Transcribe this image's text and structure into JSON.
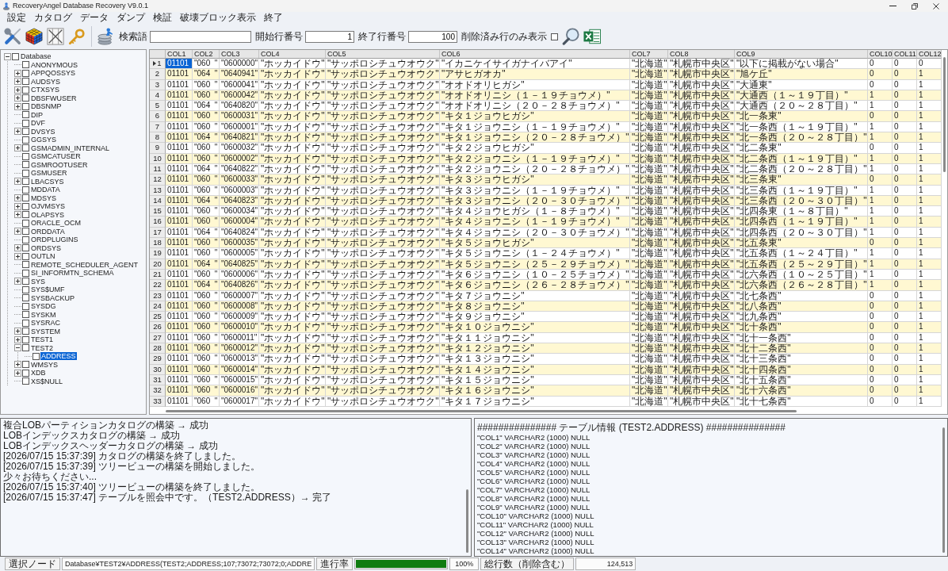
{
  "window": {
    "title": "RecoveryAngel Database Recovery V9.0.1"
  },
  "menu": [
    "設定",
    "カタログ",
    "データ",
    "ダンプ",
    "検証",
    "破壊ブロック表示",
    "終了"
  ],
  "toolbar": {
    "search": {
      "label": "検索語"
    },
    "start_row": {
      "label": "開始行番号",
      "value": "1"
    },
    "end_row": {
      "label": "終了行番号",
      "value": "100"
    },
    "deleted_only": {
      "label": "削除済み行のみ表示",
      "checked": false
    }
  },
  "tree": [
    {
      "label": "Database",
      "checked": false,
      "selected": false,
      "expanded": true,
      "children": [
        {
          "label": "ANONYMOUS",
          "checked": false,
          "selected": false
        },
        {
          "label": "APPQOSSYS",
          "checked": false,
          "selected": false,
          "expanded": false
        },
        {
          "label": "AUDSYS",
          "checked": false,
          "selected": false,
          "expanded": false
        },
        {
          "label": "CTXSYS",
          "checked": false,
          "selected": false,
          "expanded": false
        },
        {
          "label": "DBSFWUSER",
          "checked": false,
          "selected": false,
          "expanded": false
        },
        {
          "label": "DBSNMP",
          "checked": false,
          "selected": false,
          "expanded": false
        },
        {
          "label": "DIP",
          "checked": false,
          "selected": false
        },
        {
          "label": "DVF",
          "checked": false,
          "selected": false
        },
        {
          "label": "DVSYS",
          "checked": false,
          "selected": false,
          "expanded": false
        },
        {
          "label": "GGSYS",
          "checked": false,
          "selected": false
        },
        {
          "label": "GSMADMIN_INTERNAL",
          "checked": false,
          "selected": false,
          "expanded": false
        },
        {
          "label": "GSMCATUSER",
          "checked": false,
          "selected": false
        },
        {
          "label": "GSMROOTUSER",
          "checked": false,
          "selected": false
        },
        {
          "label": "GSMUSER",
          "checked": false,
          "selected": false
        },
        {
          "label": "LBACSYS",
          "checked": false,
          "selected": false,
          "expanded": false
        },
        {
          "label": "MDDATA",
          "checked": false,
          "selected": false
        },
        {
          "label": "MDSYS",
          "checked": false,
          "selected": false,
          "expanded": false
        },
        {
          "label": "OJVMSYS",
          "checked": false,
          "selected": false,
          "expanded": false
        },
        {
          "label": "OLAPSYS",
          "checked": false,
          "selected": false,
          "expanded": false
        },
        {
          "label": "ORACLE_OCM",
          "checked": false,
          "selected": false
        },
        {
          "label": "ORDDATA",
          "checked": false,
          "selected": false,
          "expanded": false
        },
        {
          "label": "ORDPLUGINS",
          "checked": false,
          "selected": false
        },
        {
          "label": "ORDSYS",
          "checked": false,
          "selected": false,
          "expanded": false
        },
        {
          "label": "OUTLN",
          "checked": false,
          "selected": false,
          "expanded": false
        },
        {
          "label": "REMOTE_SCHEDULER_AGENT",
          "checked": false,
          "selected": false
        },
        {
          "label": "SI_INFORMTN_SCHEMA",
          "checked": false,
          "selected": false
        },
        {
          "label": "SYS",
          "checked": false,
          "selected": false,
          "expanded": false
        },
        {
          "label": "SYS$UMF",
          "checked": false,
          "selected": false
        },
        {
          "label": "SYSBACKUP",
          "checked": false,
          "selected": false
        },
        {
          "label": "SYSDG",
          "checked": false,
          "selected": false
        },
        {
          "label": "SYSKM",
          "checked": false,
          "selected": false
        },
        {
          "label": "SYSRAC",
          "checked": false,
          "selected": false
        },
        {
          "label": "SYSTEM",
          "checked": false,
          "selected": false,
          "expanded": false
        },
        {
          "label": "TEST1",
          "checked": false,
          "selected": false,
          "expanded": false
        },
        {
          "label": "TEST2",
          "checked": false,
          "selected": false,
          "expanded": true,
          "children": [
            {
              "label": "ADDRESS",
              "checked": false,
              "selected": true
            }
          ]
        },
        {
          "label": "WMSYS",
          "checked": false,
          "selected": false,
          "expanded": false
        },
        {
          "label": "XDB",
          "checked": false,
          "selected": false,
          "expanded": false
        },
        {
          "label": "XS$NULL",
          "checked": false,
          "selected": false
        }
      ]
    }
  ],
  "table": {
    "columns": [
      "COL1",
      "COL2",
      "COL3",
      "COL4",
      "COL5",
      "COL6",
      "COL7",
      "COL8",
      "COL9",
      "COL10",
      "COL11",
      "COL12"
    ],
    "rows": [
      {
        "number": "1",
        "selected": true,
        "cells": [
          "01101",
          "\"060  \"",
          "\"0600000\"",
          "\"ホッカイドウ\"",
          "\"サッポロシチュウオウク\"",
          "\"イカニケイサイガナイバアイ\"",
          "\"北海道\"",
          "\"札幌市中央区\"",
          "\"以下に掲載がない場合\"",
          "0",
          "0",
          "0"
        ]
      },
      {
        "number": "2",
        "selected": false,
        "cells": [
          "01101",
          "\"064  \"",
          "\"0640941\"",
          "\"ホッカイドウ\"",
          "\"サッポロシチュウオウク\"",
          "\"アサヒガオカ\"",
          "\"北海道\"",
          "\"札幌市中央区\"",
          "\"旭ケ丘\"",
          "0",
          "0",
          "1"
        ]
      },
      {
        "number": "3",
        "selected": false,
        "cells": [
          "01101",
          "\"060  \"",
          "\"0600041\"",
          "\"ホッカイドウ\"",
          "\"サッポロシチュウオウク\"",
          "\"オオドオリヒガシ\"",
          "\"北海道\"",
          "\"札幌市中央区\"",
          "\"大通東\"",
          "0",
          "0",
          "1"
        ]
      },
      {
        "number": "4",
        "selected": false,
        "cells": [
          "01101",
          "\"060  \"",
          "\"0600042\"",
          "\"ホッカイドウ\"",
          "\"サッポロシチュウオウク\"",
          "\"オオドオリニシ（１－１９チョウメ）\"",
          "\"北海道\"",
          "\"札幌市中央区\"",
          "\"大通西（１～１９丁目）\"",
          "1",
          "0",
          "1"
        ]
      },
      {
        "number": "5",
        "selected": false,
        "cells": [
          "01101",
          "\"064  \"",
          "\"0640820\"",
          "\"ホッカイドウ\"",
          "\"サッポロシチュウオウク\"",
          "\"オオドオリニシ（２０－２８チョウメ）\"",
          "\"北海道\"",
          "\"札幌市中央区\"",
          "\"大通西（２０～２８丁目）\"",
          "1",
          "0",
          "1"
        ]
      },
      {
        "number": "6",
        "selected": false,
        "cells": [
          "01101",
          "\"060  \"",
          "\"0600031\"",
          "\"ホッカイドウ\"",
          "\"サッポロシチュウオウク\"",
          "\"キタ１ジョウヒガシ\"",
          "\"北海道\"",
          "\"札幌市中央区\"",
          "\"北一条東\"",
          "0",
          "0",
          "1"
        ]
      },
      {
        "number": "7",
        "selected": false,
        "cells": [
          "01101",
          "\"060  \"",
          "\"0600001\"",
          "\"ホッカイドウ\"",
          "\"サッポロシチュウオウク\"",
          "\"キタ１ジョウニシ（１－１９チョウメ）\"",
          "\"北海道\"",
          "\"札幌市中央区\"",
          "\"北一条西（１～１９丁目）\"",
          "1",
          "0",
          "1"
        ]
      },
      {
        "number": "8",
        "selected": false,
        "cells": [
          "01101",
          "\"064  \"",
          "\"0640821\"",
          "\"ホッカイドウ\"",
          "\"サッポロシチュウオウク\"",
          "\"キタ１ジョウニシ（２０－２８チョウメ）\"",
          "\"北海道\"",
          "\"札幌市中央区\"",
          "\"北一条西（２０～２８丁目）\"",
          "1",
          "0",
          "1"
        ]
      },
      {
        "number": "9",
        "selected": false,
        "cells": [
          "01101",
          "\"060  \"",
          "\"0600032\"",
          "\"ホッカイドウ\"",
          "\"サッポロシチュウオウク\"",
          "\"キタ２ジョウヒガシ\"",
          "\"北海道\"",
          "\"札幌市中央区\"",
          "\"北二条東\"",
          "0",
          "0",
          "1"
        ]
      },
      {
        "number": "10",
        "selected": false,
        "cells": [
          "01101",
          "\"060  \"",
          "\"0600002\"",
          "\"ホッカイドウ\"",
          "\"サッポロシチュウオウク\"",
          "\"キタ２ジョウニシ（１－１９チョウメ）\"",
          "\"北海道\"",
          "\"札幌市中央区\"",
          "\"北二条西（１～１９丁目）\"",
          "1",
          "0",
          "1"
        ]
      },
      {
        "number": "11",
        "selected": false,
        "cells": [
          "01101",
          "\"064  \"",
          "\"0640822\"",
          "\"ホッカイドウ\"",
          "\"サッポロシチュウオウク\"",
          "\"キタ２ジョウニシ（２０－２８チョウメ）\"",
          "\"北海道\"",
          "\"札幌市中央区\"",
          "\"北二条西（２０～２８丁目）\"",
          "1",
          "0",
          "1"
        ]
      },
      {
        "number": "12",
        "selected": false,
        "cells": [
          "01101",
          "\"060  \"",
          "\"0600033\"",
          "\"ホッカイドウ\"",
          "\"サッポロシチュウオウク\"",
          "\"キタ３ジョウヒガシ\"",
          "\"北海道\"",
          "\"札幌市中央区\"",
          "\"北三条東\"",
          "0",
          "0",
          "1"
        ]
      },
      {
        "number": "13",
        "selected": false,
        "cells": [
          "01101",
          "\"060  \"",
          "\"0600003\"",
          "\"ホッカイドウ\"",
          "\"サッポロシチュウオウク\"",
          "\"キタ３ジョウニシ（１－１９チョウメ）\"",
          "\"北海道\"",
          "\"札幌市中央区\"",
          "\"北三条西（１～１９丁目）\"",
          "1",
          "0",
          "1"
        ]
      },
      {
        "number": "14",
        "selected": false,
        "cells": [
          "01101",
          "\"064  \"",
          "\"0640823\"",
          "\"ホッカイドウ\"",
          "\"サッポロシチュウオウク\"",
          "\"キタ３ジョウニシ（２０－３０チョウメ）\"",
          "\"北海道\"",
          "\"札幌市中央区\"",
          "\"北三条西（２０～３０丁目）\"",
          "1",
          "0",
          "1"
        ]
      },
      {
        "number": "15",
        "selected": false,
        "cells": [
          "01101",
          "\"060  \"",
          "\"0600034\"",
          "\"ホッカイドウ\"",
          "\"サッポロシチュウオウク\"",
          "\"キタ４ジョウヒガシ（１－８チョウメ）\"",
          "\"北海道\"",
          "\"札幌市中央区\"",
          "\"北四条東（１～８丁目）\"",
          "1",
          "0",
          "1"
        ]
      },
      {
        "number": "16",
        "selected": false,
        "cells": [
          "01101",
          "\"060  \"",
          "\"0600004\"",
          "\"ホッカイドウ\"",
          "\"サッポロシチュウオウク\"",
          "\"キタ４ジョウニシ（１－１９チョウメ）\"",
          "\"北海道\"",
          "\"札幌市中央区\"",
          "\"北四条西（１～１９丁目）\"",
          "1",
          "0",
          "1"
        ]
      },
      {
        "number": "17",
        "selected": false,
        "cells": [
          "01101",
          "\"064  \"",
          "\"0640824\"",
          "\"ホッカイドウ\"",
          "\"サッポロシチュウオウク\"",
          "\"キタ４ジョウニシ（２０－３０チョウメ）\"",
          "\"北海道\"",
          "\"札幌市中央区\"",
          "\"北四条西（２０～３０丁目）\"",
          "1",
          "0",
          "1"
        ]
      },
      {
        "number": "18",
        "selected": false,
        "cells": [
          "01101",
          "\"060  \"",
          "\"0600035\"",
          "\"ホッカイドウ\"",
          "\"サッポロシチュウオウク\"",
          "\"キタ５ジョウヒガシ\"",
          "\"北海道\"",
          "\"札幌市中央区\"",
          "\"北五条東\"",
          "0",
          "0",
          "1"
        ]
      },
      {
        "number": "19",
        "selected": false,
        "cells": [
          "01101",
          "\"060  \"",
          "\"0600005\"",
          "\"ホッカイドウ\"",
          "\"サッポロシチュウオウク\"",
          "\"キタ５ジョウニシ（１－２４チョウメ）\"",
          "\"北海道\"",
          "\"札幌市中央区\"",
          "\"北五条西（１～２４丁目）\"",
          "1",
          "0",
          "1"
        ]
      },
      {
        "number": "20",
        "selected": false,
        "cells": [
          "01101",
          "\"064  \"",
          "\"0640825\"",
          "\"ホッカイドウ\"",
          "\"サッポロシチュウオウク\"",
          "\"キタ５ジョウニシ（２５－２９チョウメ）\"",
          "\"北海道\"",
          "\"札幌市中央区\"",
          "\"北五条西（２５～２９丁目）\"",
          "1",
          "0",
          "1"
        ]
      },
      {
        "number": "21",
        "selected": false,
        "cells": [
          "01101",
          "\"060  \"",
          "\"0600006\"",
          "\"ホッカイドウ\"",
          "\"サッポロシチュウオウク\"",
          "\"キタ６ジョウニシ（１０－２５チョウメ）\"",
          "\"北海道\"",
          "\"札幌市中央区\"",
          "\"北六条西（１０～２５丁目）\"",
          "1",
          "0",
          "1"
        ]
      },
      {
        "number": "22",
        "selected": false,
        "cells": [
          "01101",
          "\"064  \"",
          "\"0640826\"",
          "\"ホッカイドウ\"",
          "\"サッポロシチュウオウク\"",
          "\"キタ６ジョウニシ（２６－２８チョウメ）\"",
          "\"北海道\"",
          "\"札幌市中央区\"",
          "\"北六条西（２６～２８丁目）\"",
          "1",
          "0",
          "1"
        ]
      },
      {
        "number": "23",
        "selected": false,
        "cells": [
          "01101",
          "\"060  \"",
          "\"0600007\"",
          "\"ホッカイドウ\"",
          "\"サッポロシチュウオウク\"",
          "\"キタ７ジョウニシ\"",
          "\"北海道\"",
          "\"札幌市中央区\"",
          "\"北七条西\"",
          "0",
          "0",
          "1"
        ]
      },
      {
        "number": "24",
        "selected": false,
        "cells": [
          "01101",
          "\"060  \"",
          "\"0600008\"",
          "\"ホッカイドウ\"",
          "\"サッポロシチュウオウク\"",
          "\"キタ８ジョウニシ\"",
          "\"北海道\"",
          "\"札幌市中央区\"",
          "\"北八条西\"",
          "0",
          "0",
          "1"
        ]
      },
      {
        "number": "25",
        "selected": false,
        "cells": [
          "01101",
          "\"060  \"",
          "\"0600009\"",
          "\"ホッカイドウ\"",
          "\"サッポロシチュウオウク\"",
          "\"キタ９ジョウニシ\"",
          "\"北海道\"",
          "\"札幌市中央区\"",
          "\"北九条西\"",
          "0",
          "0",
          "1"
        ]
      },
      {
        "number": "26",
        "selected": false,
        "cells": [
          "01101",
          "\"060  \"",
          "\"0600010\"",
          "\"ホッカイドウ\"",
          "\"サッポロシチュウオウク\"",
          "\"キタ１０ジョウニシ\"",
          "\"北海道\"",
          "\"札幌市中央区\"",
          "\"北十条西\"",
          "0",
          "0",
          "1"
        ]
      },
      {
        "number": "27",
        "selected": false,
        "cells": [
          "01101",
          "\"060  \"",
          "\"0600011\"",
          "\"ホッカイドウ\"",
          "\"サッポロシチュウオウク\"",
          "\"キタ１１ジョウニシ\"",
          "\"北海道\"",
          "\"札幌市中央区\"",
          "\"北十一条西\"",
          "0",
          "0",
          "1"
        ]
      },
      {
        "number": "28",
        "selected": false,
        "cells": [
          "01101",
          "\"060  \"",
          "\"0600012\"",
          "\"ホッカイドウ\"",
          "\"サッポロシチュウオウク\"",
          "\"キタ１２ジョウニシ\"",
          "\"北海道\"",
          "\"札幌市中央区\"",
          "\"北十二条西\"",
          "0",
          "0",
          "1"
        ]
      },
      {
        "number": "29",
        "selected": false,
        "cells": [
          "01101",
          "\"060  \"",
          "\"0600013\"",
          "\"ホッカイドウ\"",
          "\"サッポロシチュウオウク\"",
          "\"キタ１３ジョウニシ\"",
          "\"北海道\"",
          "\"札幌市中央区\"",
          "\"北十三条西\"",
          "0",
          "0",
          "1"
        ]
      },
      {
        "number": "30",
        "selected": false,
        "cells": [
          "01101",
          "\"060  \"",
          "\"0600014\"",
          "\"ホッカイドウ\"",
          "\"サッポロシチュウオウク\"",
          "\"キタ１４ジョウニシ\"",
          "\"北海道\"",
          "\"札幌市中央区\"",
          "\"北十四条西\"",
          "0",
          "0",
          "1"
        ]
      },
      {
        "number": "31",
        "selected": false,
        "cells": [
          "01101",
          "\"060  \"",
          "\"0600015\"",
          "\"ホッカイドウ\"",
          "\"サッポロシチュウオウク\"",
          "\"キタ１５ジョウニシ\"",
          "\"北海道\"",
          "\"札幌市中央区\"",
          "\"北十五条西\"",
          "0",
          "0",
          "1"
        ]
      },
      {
        "number": "32",
        "selected": false,
        "cells": [
          "01101",
          "\"060  \"",
          "\"0600016\"",
          "\"ホッカイドウ\"",
          "\"サッポロシチュウオウク\"",
          "\"キタ１６ジョウニシ\"",
          "\"北海道\"",
          "\"札幌市中央区\"",
          "\"北十六条西\"",
          "0",
          "0",
          "1"
        ]
      },
      {
        "number": "33",
        "selected": false,
        "cells": [
          "01101",
          "\"060  \"",
          "\"0600017\"",
          "\"ホッカイドウ\"",
          "\"サッポロシチュウオウク\"",
          "\"キタ１７ジョウニシ\"",
          "\"北海道\"",
          "\"札幌市中央区\"",
          "\"北十七条西\"",
          "0",
          "0",
          "1"
        ]
      }
    ]
  },
  "log": [
    "複合LOBパーティションカタログの構築 → 成功",
    "LOBインデックスカタログの構築 → 成功",
    "LOBインデックスヘッダーカタログの構築 → 成功",
    "[2026/07/15 15:37:39] カタログの構築を終了しました。",
    "[2026/07/15 15:37:39] ツリービューの構築を開始しました。",
    "少々お待ちください...",
    "[2026/07/15 15:37:40] ツリービューの構築を終了しました。",
    "[2026/07/15 15:37:47] テーブルを照会中です。（TEST2.ADDRESS）→ 完了"
  ],
  "table_info": {
    "header": "############### テーブル情報 (TEST2.ADDRESS) ###############",
    "lines": [
      "\"COL1\" VARCHAR2 (1000) NULL",
      "\"COL2\" VARCHAR2 (1000) NULL",
      "\"COL3\" VARCHAR2 (1000) NULL",
      "\"COL4\" VARCHAR2 (1000) NULL",
      "\"COL5\" VARCHAR2 (1000) NULL",
      "\"COL6\" VARCHAR2 (1000) NULL",
      "\"COL7\" VARCHAR2 (1000) NULL",
      "\"COL8\" VARCHAR2 (1000) NULL",
      "\"COL9\" VARCHAR2 (1000) NULL",
      "\"COL10\" VARCHAR2 (1000) NULL",
      "\"COL11\" VARCHAR2 (1000) NULL",
      "\"COL12\" VARCHAR2 (1000) NULL",
      "\"COL13\" VARCHAR2 (1000) NULL",
      "\"COL14\" VARCHAR2 (1000) NULL"
    ]
  },
  "status_bar": {
    "node_label": "選択ノード",
    "node_path": "Database¥TEST2¥ADDRESS(TEST2;ADDRESS;107;73072;73072;0;ADDRE",
    "progress_label": "進行率",
    "progress": {
      "level": 1,
      "reading": "100%"
    },
    "total_label": "総行数（削除含む）",
    "total": "124,513"
  }
}
